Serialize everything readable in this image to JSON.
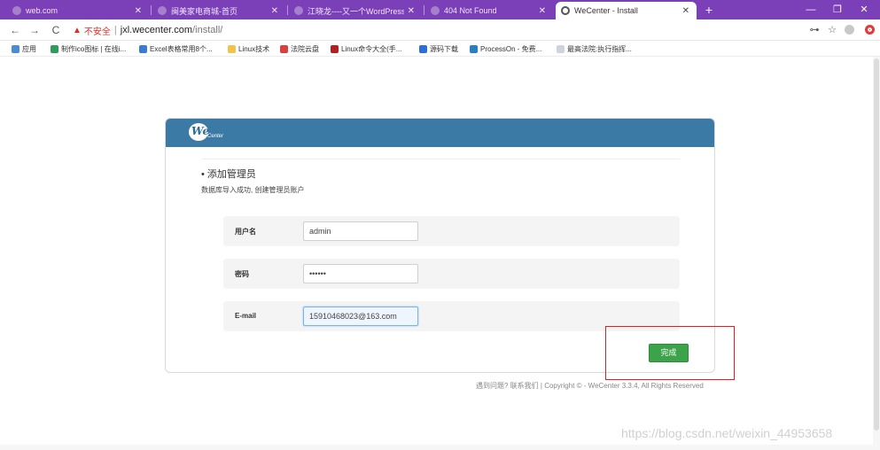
{
  "browser": {
    "tabs": [
      {
        "label": "web.com",
        "active": false
      },
      {
        "label": "闽美家电商城-首页",
        "active": false
      },
      {
        "label": "江晓龙----又一个WordPress",
        "active": false
      },
      {
        "label": "404 Not Found",
        "active": false
      },
      {
        "label": "WeCenter - Install",
        "active": true
      }
    ],
    "new_tab": "+",
    "controls": {
      "minimize": "—",
      "maximize": "❐",
      "close": "✕"
    },
    "nav": {
      "back": "←",
      "forward": "→",
      "reload": "C"
    },
    "address": {
      "security_icon": "▲",
      "security_text": "不安全",
      "separator": "|",
      "host": "jxl.wecenter.com",
      "path": "/install/"
    },
    "toolbar_icons": {
      "key": "⊶",
      "star": "☆"
    },
    "bookmarks": [
      {
        "label": "应用",
        "icon_color": "#4a8bd4"
      },
      {
        "label": "制作ico图标 | 在线i...",
        "icon_color": "#2e9c5a"
      },
      {
        "label": "Excel表格常用8个...",
        "icon_color": "#3a7bd5"
      },
      {
        "label": "Linux技术",
        "icon_color": "#f2c24b"
      },
      {
        "label": "法院云盘",
        "icon_color": "#d94040"
      },
      {
        "label": "Linux命令大全(手...",
        "icon_color": "#b32020"
      },
      {
        "label": "源码下载",
        "icon_color": "#2b6fd6"
      },
      {
        "label": "ProcessOn - 免费...",
        "icon_color": "#2a7ec2"
      },
      {
        "label": "最高法院:执行指挥...",
        "icon_color": "#cfd4dc"
      }
    ]
  },
  "page": {
    "logo": {
      "we": "We",
      "center": "Center"
    },
    "section_title": "• 添加管理员",
    "section_sub": "数据库导入成功, 创建管理员账户",
    "fields": [
      {
        "label": "用户名",
        "value": "admin"
      },
      {
        "label": "密码",
        "value": "••••••"
      },
      {
        "label": "E-mail",
        "value": "15910468023@163.com"
      }
    ],
    "submit_label": "完成",
    "footer": "遇到问题? 联系我们 | Copyright © - WeCenter 3.3.4, All Rights Reserved",
    "watermark": "https://blog.csdn.net/weixin_44953658"
  },
  "colors": {
    "tab_bar": "#7b3fb8",
    "header": "#3c7aa6",
    "submit": "#3ca34a",
    "annotation": "#e02020"
  }
}
